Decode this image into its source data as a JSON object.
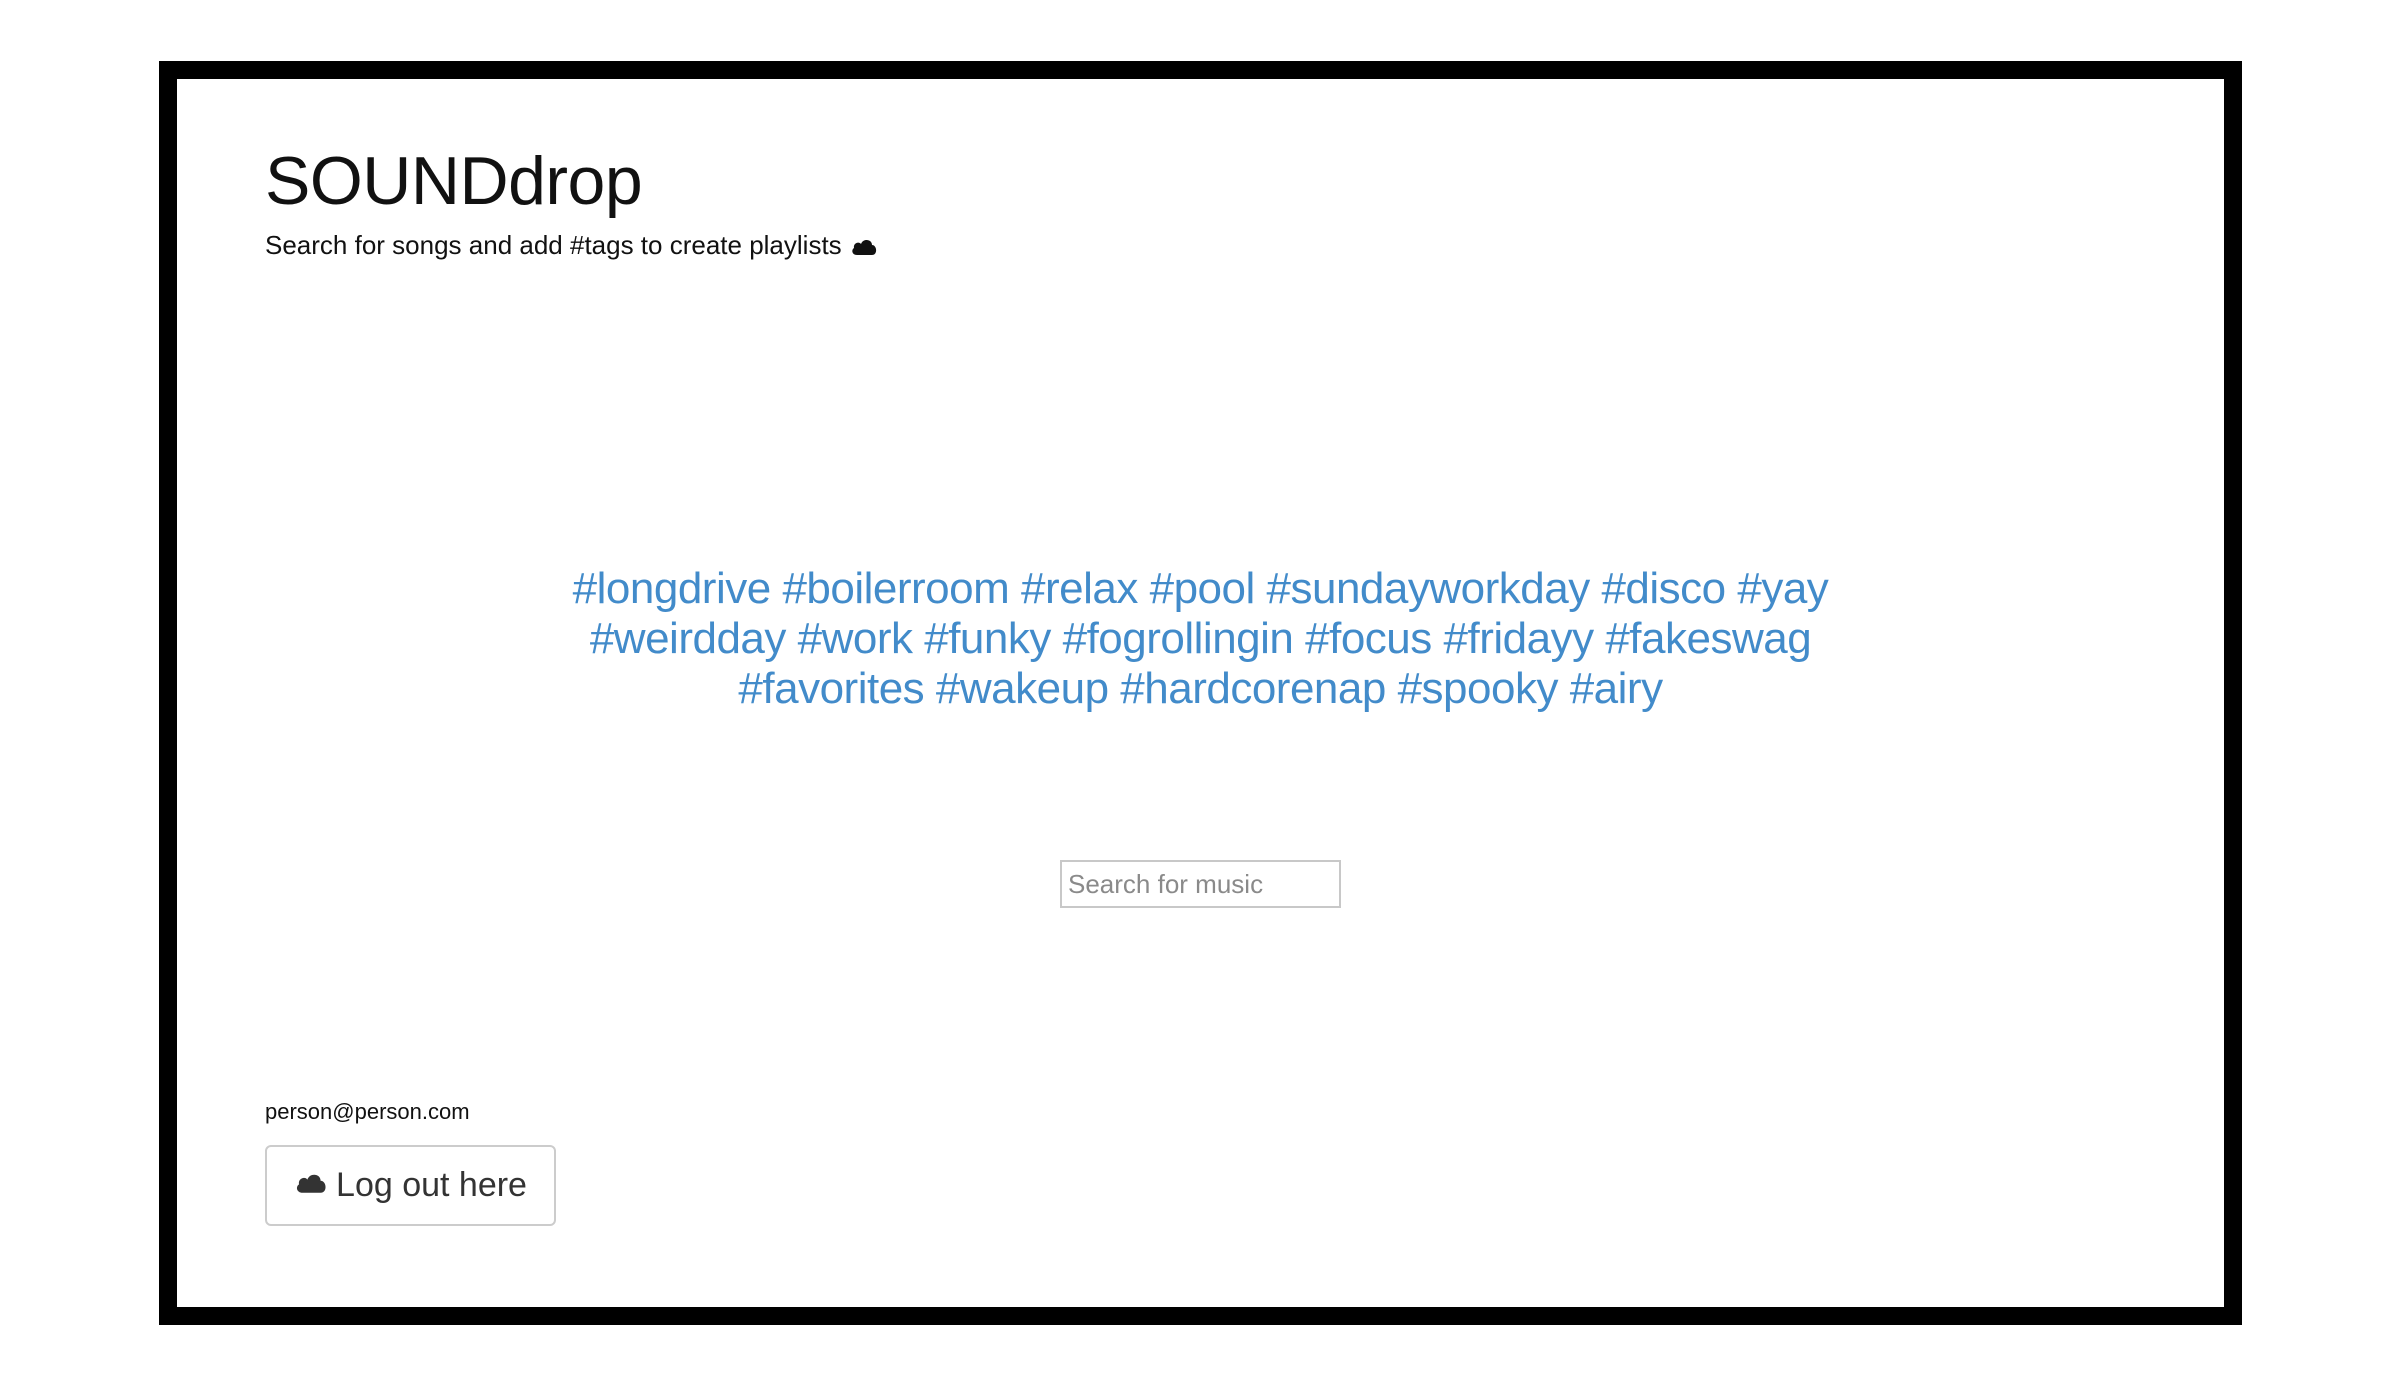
{
  "header": {
    "title": "SOUNDdrop",
    "tagline": "Search for songs and add #tags to create playlists",
    "tagline_icon": "cloud-icon"
  },
  "tags": {
    "items": [
      "#longdrive",
      "#boilerroom",
      "#relax",
      "#pool",
      "#sundayworkday",
      "#disco",
      "#yay",
      "#weirdday",
      "#work",
      "#funky",
      "#fogrollingin",
      "#focus",
      "#fridayy",
      "#fakeswag",
      "#favorites",
      "#wakeup",
      "#hardcorenap",
      "#spooky",
      "#airy"
    ],
    "color": "#428bca"
  },
  "search": {
    "placeholder": "Search for music",
    "value": ""
  },
  "user": {
    "email": "person@person.com",
    "logout_label": "Log out here",
    "logout_icon": "cloud-icon"
  }
}
